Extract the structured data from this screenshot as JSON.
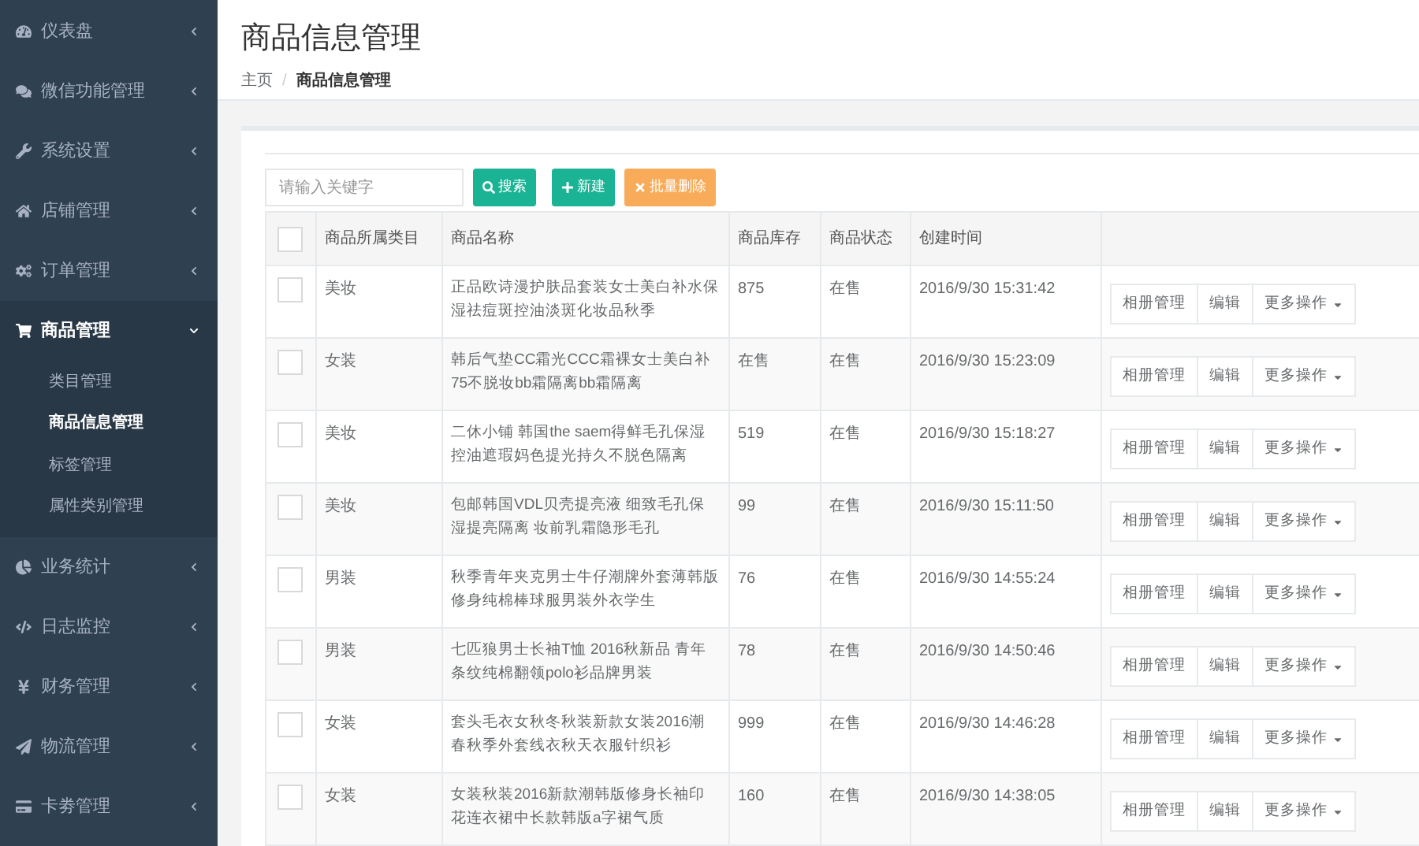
{
  "sidebar": {
    "items": [
      {
        "label": "仪表盘",
        "expanded": false
      },
      {
        "label": "微信功能管理",
        "expanded": false
      },
      {
        "label": "系统设置",
        "expanded": false
      },
      {
        "label": "店铺管理",
        "expanded": false
      },
      {
        "label": "订单管理",
        "expanded": false
      },
      {
        "label": "商品管理",
        "expanded": true,
        "children": [
          {
            "label": "类目管理",
            "selected": false
          },
          {
            "label": "商品信息管理",
            "selected": true
          },
          {
            "label": "标签管理",
            "selected": false
          },
          {
            "label": "属性类别管理",
            "selected": false
          }
        ]
      },
      {
        "label": "业务统计",
        "expanded": false
      },
      {
        "label": "日志监控",
        "expanded": false
      },
      {
        "label": "财务管理",
        "expanded": false
      },
      {
        "label": "物流管理",
        "expanded": false
      },
      {
        "label": "卡劵管理",
        "expanded": false
      }
    ]
  },
  "page": {
    "title": "商品信息管理",
    "breadcrumb": [
      "主页",
      "商品信息管理"
    ],
    "breadcrumb_separator": "/"
  },
  "toolbar": {
    "search": {
      "placeholder": "请输入关键字"
    },
    "buttons": [
      {
        "kind": "search",
        "label": "搜索"
      },
      {
        "kind": "create",
        "label": "新建"
      },
      {
        "kind": "delete",
        "label": "批量删除"
      }
    ]
  },
  "table": {
    "header_checked": false,
    "columns": [
      "商品所属类目",
      "商品名称",
      "商品库存",
      "商品状态",
      "创建时间"
    ],
    "rows": [
      {
        "checked": false,
        "category": "美妆",
        "name": "正品欧诗漫护肤品套装女士美白补水保湿祛痘斑控油淡斑化妆品秋季",
        "stock": "875",
        "status": "在售",
        "created": "2016/9/30 15:31:42",
        "actions": [
          "相册管理",
          "编辑",
          "更多操作"
        ]
      },
      {
        "checked": false,
        "category": "女装",
        "name": "韩后气垫CC霜光CCC霜裸女士美白补75不脱妆bb霜隔离bb霜隔离",
        "stock": "在售",
        "status": "在售",
        "created": "2016/9/30 15:23:09",
        "actions": [
          "相册管理",
          "编辑",
          "更多操作"
        ]
      },
      {
        "checked": false,
        "category": "美妆",
        "name": "二休小铺 韩国the saem得鲜毛孔保湿控油遮瑕妈色提光持久不脱色隔离",
        "stock": "519",
        "status": "在售",
        "created": "2016/9/30 15:18:27",
        "actions": [
          "相册管理",
          "编辑",
          "更多操作"
        ]
      },
      {
        "checked": false,
        "category": "美妆",
        "name": "包邮韩国VDL贝壳提亮液 细致毛孔保湿提亮隔离 妆前乳霜隐形毛孔",
        "stock": "99",
        "status": "在售",
        "created": "2016/9/30 15:11:50",
        "actions": [
          "相册管理",
          "编辑",
          "更多操作"
        ]
      },
      {
        "checked": false,
        "category": "男装",
        "name": "秋季青年夹克男士牛仔潮牌外套薄韩版修身纯棉棒球服男装外衣学生",
        "stock": "76",
        "status": "在售",
        "created": "2016/9/30 14:55:24",
        "actions": [
          "相册管理",
          "编辑",
          "更多操作"
        ]
      },
      {
        "checked": false,
        "category": "男装",
        "name": "七匹狼男士长袖T恤 2016秋新品 青年条纹纯棉翻领polo衫品牌男装",
        "stock": "78",
        "status": "在售",
        "created": "2016/9/30 14:50:46",
        "actions": [
          "相册管理",
          "编辑",
          "更多操作"
        ]
      },
      {
        "checked": false,
        "category": "女装",
        "name": "套头毛衣女秋冬秋装新款女装2016潮春秋季外套线衣秋天衣服针织衫",
        "stock": "999",
        "status": "在售",
        "created": "2016/9/30 14:46:28",
        "actions": [
          "相册管理",
          "编辑",
          "更多操作"
        ]
      },
      {
        "checked": false,
        "category": "女装",
        "name": "女装秋装2016新款潮韩版修身长袖印花连衣裙中长款韩版a字裙气质",
        "stock": "160",
        "status": "在售",
        "created": "2016/9/30 14:38:05",
        "actions": [
          "相册管理",
          "编辑",
          "更多操作"
        ]
      }
    ]
  }
}
